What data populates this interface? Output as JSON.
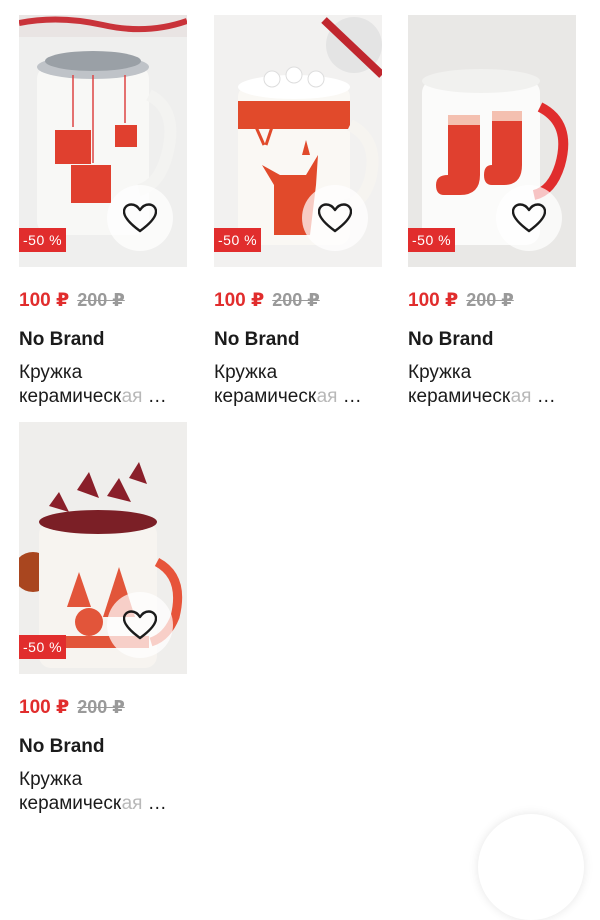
{
  "colors": {
    "accent": "#e12d2d",
    "old_price": "#9a9a9a",
    "text": "#1b1b1b"
  },
  "products": [
    {
      "discount": "-50 %",
      "price": "100 ₽",
      "old_price": "200 ₽",
      "brand": "No Brand",
      "title_line1": "Кружка",
      "title_line2_a": "керамическ",
      "title_line2_b": "ая",
      "ellipsis": "…",
      "favorite_icon": "heart-outline-icon"
    },
    {
      "discount": "-50 %",
      "price": "100 ₽",
      "old_price": "200 ₽",
      "brand": "No Brand",
      "title_line1": "Кружка",
      "title_line2_a": "керамическ",
      "title_line2_b": "ая",
      "ellipsis": "…",
      "favorite_icon": "heart-outline-icon"
    },
    {
      "discount": "-50 %",
      "price": "100 ₽",
      "old_price": "200 ₽",
      "brand": "No Brand",
      "title_line1": "Кружка",
      "title_line2_a": "керамическ",
      "title_line2_b": "ая",
      "ellipsis": "…",
      "favorite_icon": "heart-outline-icon"
    },
    {
      "discount": "-50 %",
      "price": "100 ₽",
      "old_price": "200 ₽",
      "brand": "No Brand",
      "title_line1": "Кружка",
      "title_line2_a": "керамическ",
      "title_line2_b": "ая",
      "ellipsis": "…",
      "favorite_icon": "heart-outline-icon"
    }
  ]
}
